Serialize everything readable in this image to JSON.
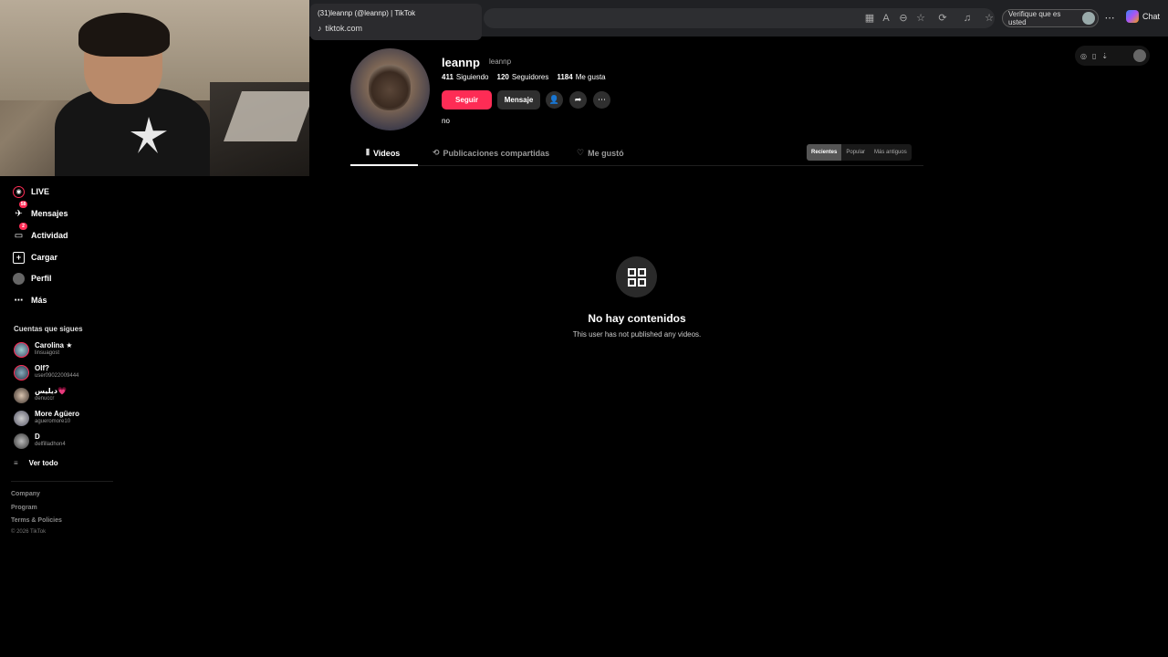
{
  "browser": {
    "tab_title": "(31)leannp (@leannp) | TikTok",
    "tab_domain": "tiktok.com",
    "verify_label": "Verifique que es usted",
    "chat_label": "Chat"
  },
  "sidebar": {
    "nav": [
      {
        "label": "LIVE",
        "icon": "live-icon"
      },
      {
        "label": "Mensajes",
        "icon": "messages-icon",
        "badge": "58"
      },
      {
        "label": "Actividad",
        "icon": "activity-icon",
        "badge": "2"
      },
      {
        "label": "Cargar",
        "icon": "upload-icon"
      },
      {
        "label": "Perfil",
        "icon": "profile-icon"
      },
      {
        "label": "Más",
        "icon": "more-icon"
      }
    ],
    "following_title": "Cuentas que sigues",
    "following": [
      {
        "name": "Carolina ★",
        "user": "linsuagost"
      },
      {
        "name": "Olf?",
        "user": "user09022009444"
      },
      {
        "name": "ديليس💗",
        "user": "denuccr"
      },
      {
        "name": "More Agüero",
        "user": "agueromore10"
      },
      {
        "name": "D",
        "user": "delfilladhon4"
      }
    ],
    "see_all": "Ver todo",
    "footer": [
      "Company",
      "Program",
      "Terms & Policies"
    ],
    "copyright": "© 2026 TikTok"
  },
  "profile": {
    "username": "leannp",
    "nickname": "leannp",
    "following_count": "411",
    "following_label": "Siguiendo",
    "followers_count": "120",
    "followers_label": "Seguidores",
    "likes_count": "1184",
    "likes_label": "Me gusta",
    "follow_btn": "Seguir",
    "message_btn": "Mensaje",
    "bio": "no"
  },
  "tabs": {
    "videos": "Videos",
    "reposts": "Publicaciones compartidas",
    "liked": "Me gustó"
  },
  "sort": [
    "Recientes",
    "Popular",
    "Más antiguos"
  ],
  "empty": {
    "title": "No hay contenidos",
    "subtitle": "This user has not published any videos."
  }
}
